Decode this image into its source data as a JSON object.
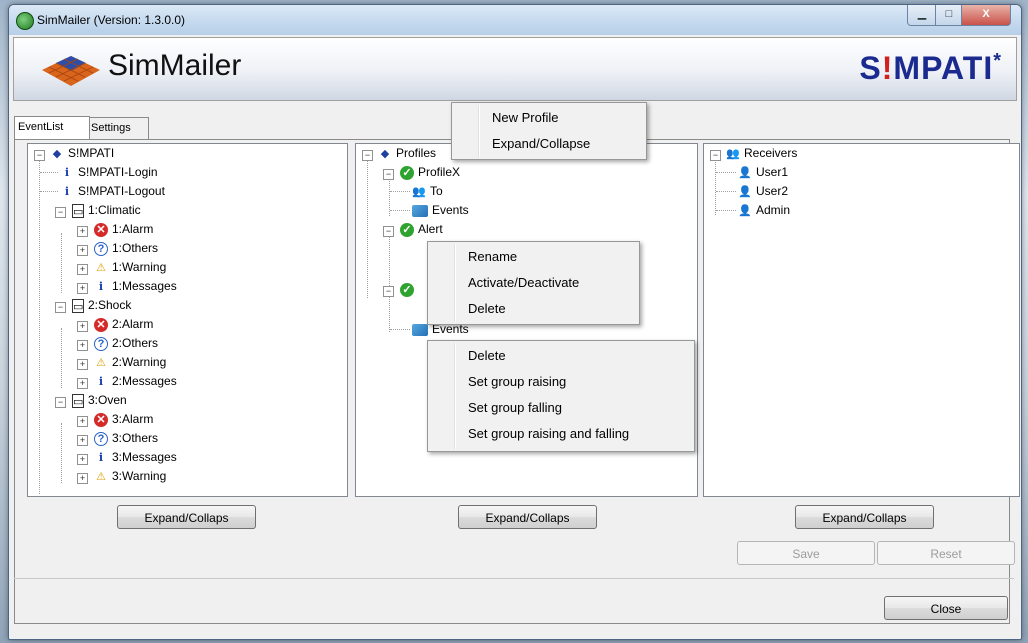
{
  "window": {
    "title": "SimMailer (Version: 1.3.0.0)"
  },
  "header": {
    "app_name": "SimMailer",
    "brand_main": "S",
    "brand_ex": "!",
    "brand_rest": "MPATI",
    "brand_star": "*"
  },
  "tabs": [
    {
      "label": "EventList"
    },
    {
      "label": "Settings"
    }
  ],
  "left_tree": {
    "root": "S!MPATI",
    "items": [
      {
        "label": "S!MPATI-Login"
      },
      {
        "label": "S!MPATI-Logout"
      },
      {
        "label": "1:Climatic"
      },
      {
        "label": "1:Alarm"
      },
      {
        "label": "1:Others"
      },
      {
        "label": "1:Warning"
      },
      {
        "label": "1:Messages"
      },
      {
        "label": "2:Shock"
      },
      {
        "label": "2:Alarm"
      },
      {
        "label": "2:Others"
      },
      {
        "label": "2:Warning"
      },
      {
        "label": "2:Messages"
      },
      {
        "label": "3:Oven"
      },
      {
        "label": "3:Alarm"
      },
      {
        "label": "3:Others"
      },
      {
        "label": "3:Messages"
      },
      {
        "label": "3:Warning"
      }
    ]
  },
  "mid_tree": {
    "root": "Profiles",
    "items": [
      {
        "label": "ProfileX"
      },
      {
        "label": "To"
      },
      {
        "label": "Events"
      },
      {
        "label": "Alert"
      },
      {
        "label": "Events"
      }
    ]
  },
  "right_tree": {
    "root": "Receivers",
    "items": [
      {
        "label": "User1"
      },
      {
        "label": "User2"
      },
      {
        "label": "Admin"
      }
    ]
  },
  "menus": {
    "profiles_menu": [
      "New Profile",
      "Expand/Collapse"
    ],
    "profile_menu": [
      "Rename",
      "Activate/Deactivate",
      "Delete"
    ],
    "events_menu": [
      "Delete",
      "Set group raising",
      "Set group falling",
      "Set group raising and falling"
    ]
  },
  "buttons": {
    "expand_left": "Expand/Collaps",
    "expand_mid": "Expand/Collaps",
    "expand_right": "Expand/Collaps",
    "save": "Save",
    "reset": "Reset",
    "close": "Close"
  },
  "window_buttons": {
    "minimize": "▁",
    "maximize": "□",
    "close": "X"
  }
}
